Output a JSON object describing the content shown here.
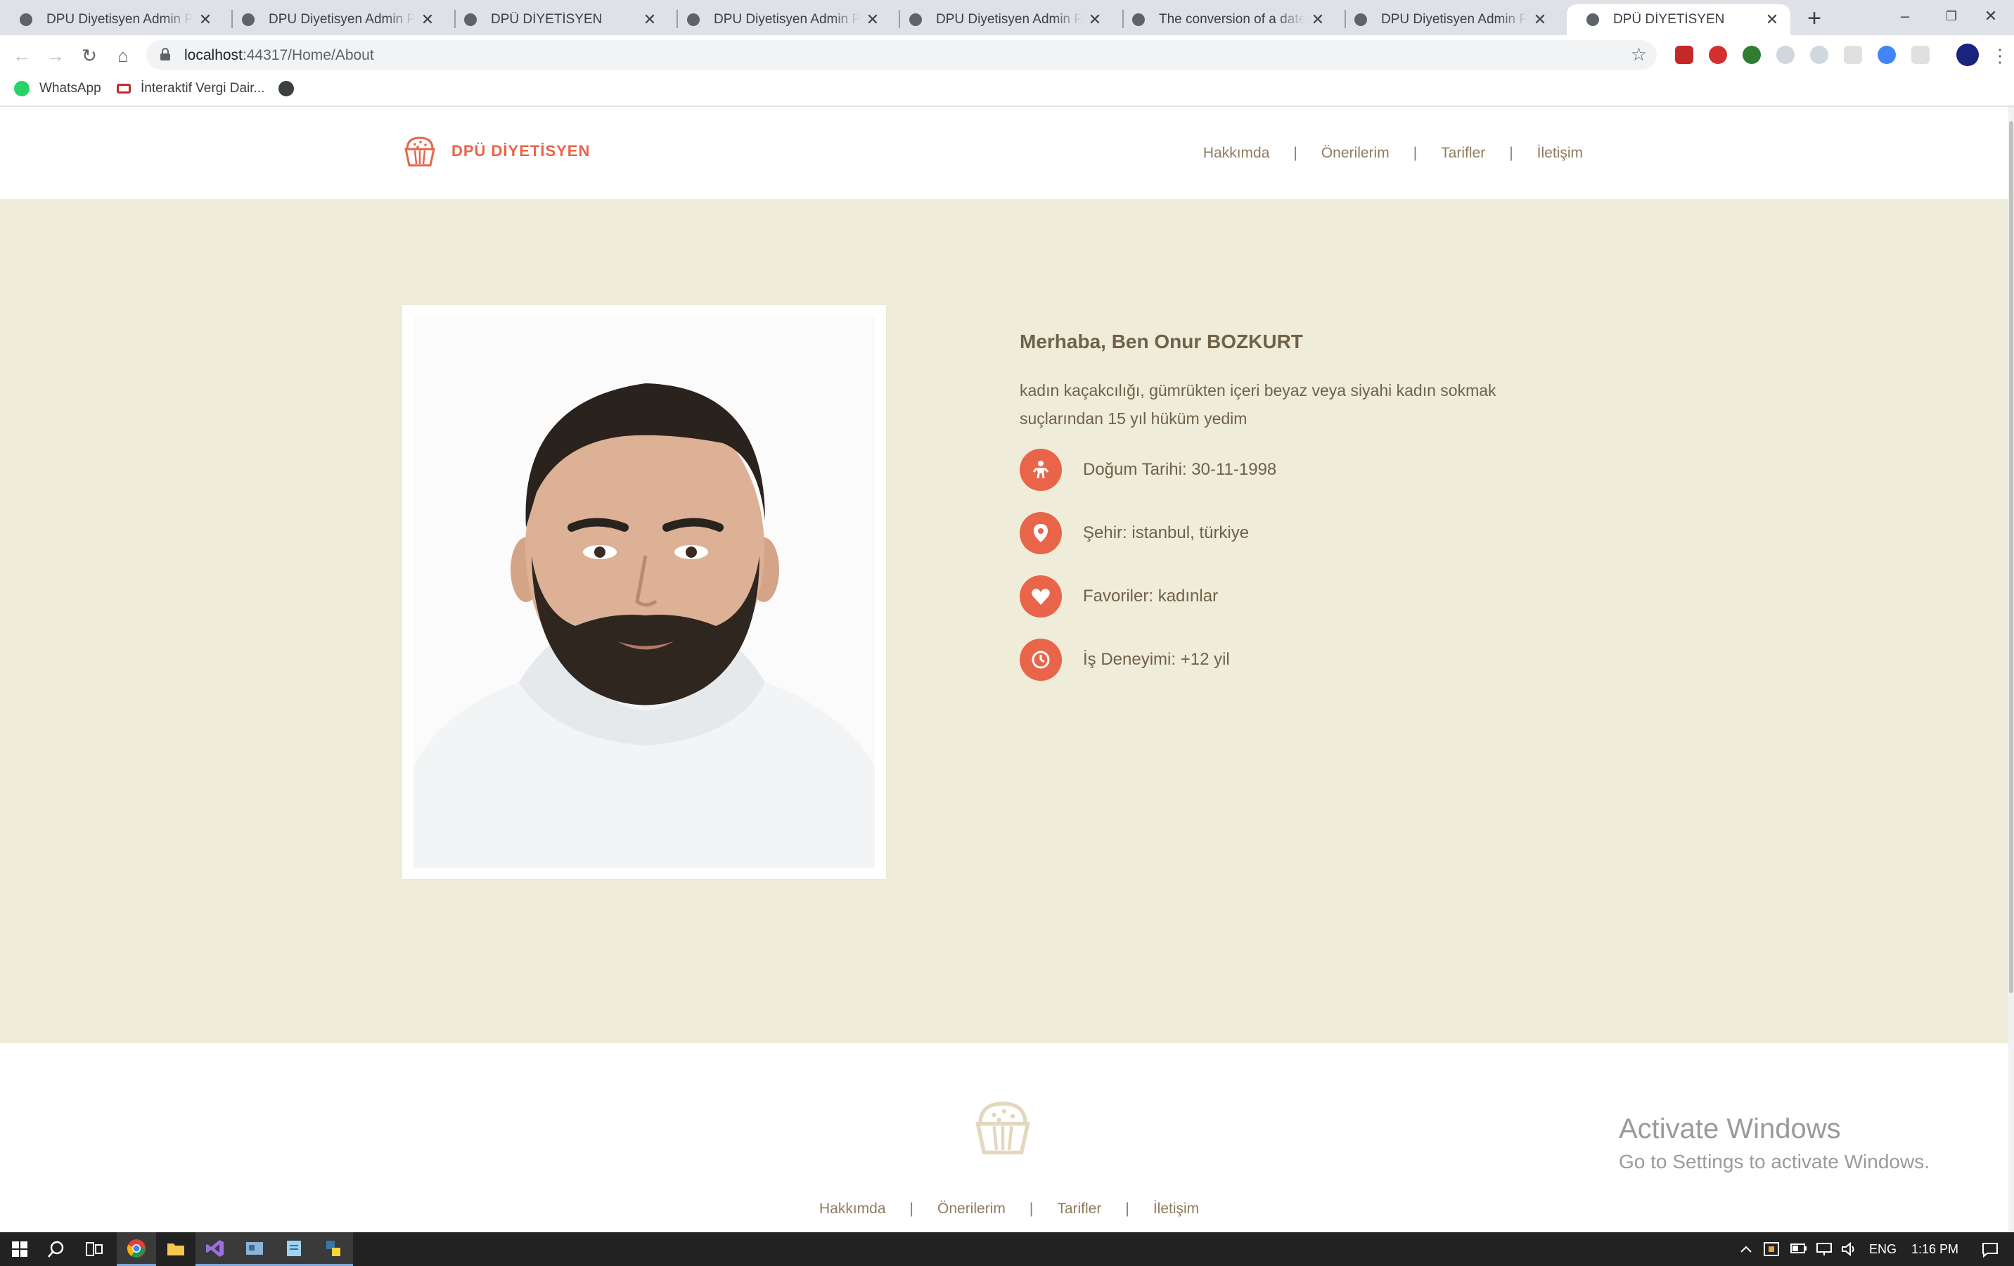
{
  "browser": {
    "tabs": [
      {
        "title": "DPU Diyetisyen Admin Panel",
        "active": false
      },
      {
        "title": "DPU Diyetisyen Admin Panel",
        "active": false
      },
      {
        "title": "DPÜ DİYETİSYEN",
        "active": false
      },
      {
        "title": "DPU Diyetisyen Admin Panel",
        "active": false
      },
      {
        "title": "DPU Diyetisyen Admin Panel",
        "active": false
      },
      {
        "title": "The conversion of a datetime",
        "active": false
      },
      {
        "title": "DPU Diyetisyen Admin Panel",
        "active": false
      },
      {
        "title": "DPÜ DİYETİSYEN",
        "active": true
      }
    ],
    "close_glyph": "✕",
    "new_tab_glyph": "+",
    "window_controls": {
      "minimize": "–",
      "restore": "❐",
      "close": "✕"
    },
    "nav": {
      "back": "←",
      "forward": "→",
      "reload": "↻",
      "home": "⌂"
    },
    "url_host": "localhost",
    "url_path": ":44317/Home/About",
    "star_glyph": "☆",
    "menu_glyph": "⋮",
    "bookmarks": [
      {
        "label": "WhatsApp",
        "icon": "whatsapp-icon",
        "color": "#25d366"
      },
      {
        "label": "İnteraktif Vergi Dair...",
        "icon": "vergi-icon",
        "color": "#c62828"
      }
    ]
  },
  "site": {
    "brand": "DPÜ DİYETİSYEN",
    "nav": [
      {
        "label": "Hakkımda"
      },
      {
        "label": "Önerilerim"
      },
      {
        "label": "Tarifler"
      },
      {
        "label": "İletişim"
      }
    ],
    "separator": "|",
    "accent_color": "#e8654a",
    "background_color": "#f0ecda"
  },
  "about": {
    "title": "Merhaba, Ben Onur BOZKURT",
    "description": "kadın kaçakcılığı, gümrükten içeri beyaz veya siyahi kadın sokmak suçlarından 15 yıl hüküm yedim",
    "info": [
      {
        "label": "Doğum Tarihi: 30-11-1998",
        "icon": "baby-icon"
      },
      {
        "label": "Şehir: istanbul, türkiye",
        "icon": "location-pin-icon"
      },
      {
        "label": "Favoriler: kadınlar",
        "icon": "heart-icon"
      },
      {
        "label": "İş Deneyimi: +12 yil",
        "icon": "clock-icon"
      }
    ]
  },
  "stray_text": ";",
  "watermark": {
    "line1": "Activate Windows",
    "line2": "Go to Settings to activate Windows."
  },
  "taskbar": {
    "language": "ENG",
    "time": "1:16 PM"
  }
}
